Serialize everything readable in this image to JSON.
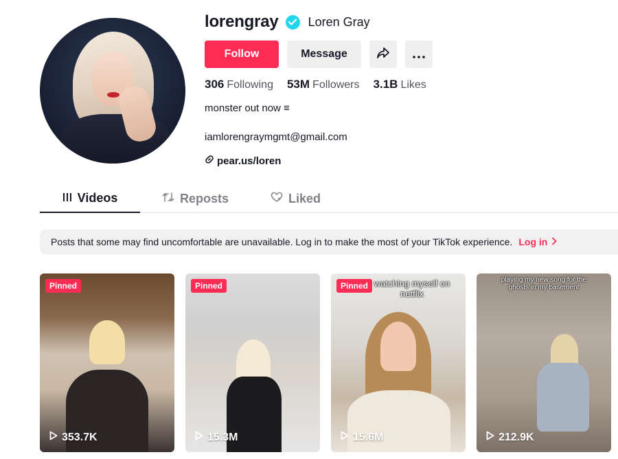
{
  "profile": {
    "username": "lorengray",
    "display_name": "Loren Gray",
    "verified": true,
    "bio": "monster out now ≡",
    "email": "iamlorengraymgmt@gmail.com",
    "link": "pear.us/loren"
  },
  "buttons": {
    "follow": "Follow",
    "message": "Message",
    "share_icon": "share-icon",
    "more_icon": "more-icon"
  },
  "stats": {
    "following_count": "306",
    "following_label": "Following",
    "followers_count": "53M",
    "followers_label": "Followers",
    "likes_count": "3.1B",
    "likes_label": "Likes"
  },
  "tabs": [
    {
      "label": "Videos",
      "icon": "grid-icon",
      "active": true
    },
    {
      "label": "Reposts",
      "icon": "repost-icon",
      "active": false
    },
    {
      "label": "Liked",
      "icon": "heart-icon",
      "active": false
    }
  ],
  "notice": {
    "text": "Posts that some may find uncomfortable are unavailable. Log in to make the most of your TikTok experience.",
    "login_label": "Log in"
  },
  "videos": [
    {
      "pinned": true,
      "pinned_label": "Pinned",
      "views": "353.7K",
      "caption": ""
    },
    {
      "pinned": true,
      "pinned_label": "Pinned",
      "views": "15.3M",
      "caption": ""
    },
    {
      "pinned": true,
      "pinned_label": "Pinned",
      "views": "15.6M",
      "caption": "watching myself on netflix"
    },
    {
      "pinned": false,
      "pinned_label": "",
      "views": "212.9K",
      "caption": "playing my new song for the ghosts in my basement"
    }
  ],
  "colors": {
    "accent": "#fe2c55",
    "verified": "#20d5ec",
    "text": "#161823"
  }
}
